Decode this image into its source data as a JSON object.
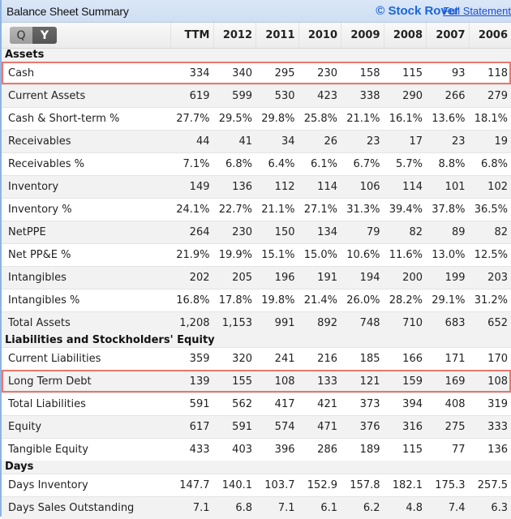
{
  "header": {
    "title": "Balance Sheet Summary",
    "brand": "© Stock Rover",
    "full_statement_link": "Full Statement"
  },
  "period_toggle": {
    "quarterly_label": "Q",
    "yearly_label": "Y",
    "selected": "Y"
  },
  "columns": [
    "TTM",
    "2012",
    "2011",
    "2010",
    "2009",
    "2008",
    "2007",
    "2006"
  ],
  "sections": [
    {
      "title": "Assets",
      "rows": [
        {
          "label": "Cash",
          "values": [
            "334",
            "340",
            "295",
            "230",
            "158",
            "115",
            "93",
            "118"
          ],
          "highlighted": true
        },
        {
          "label": "Current Assets",
          "values": [
            "619",
            "599",
            "530",
            "423",
            "338",
            "290",
            "266",
            "279"
          ]
        },
        {
          "label": "Cash & Short-term %",
          "values": [
            "27.7%",
            "29.5%",
            "29.8%",
            "25.8%",
            "21.1%",
            "16.1%",
            "13.6%",
            "18.1%"
          ]
        },
        {
          "label": "Receivables",
          "values": [
            "44",
            "41",
            "34",
            "26",
            "23",
            "17",
            "23",
            "19"
          ]
        },
        {
          "label": "Receivables %",
          "values": [
            "7.1%",
            "6.8%",
            "6.4%",
            "6.1%",
            "6.7%",
            "5.7%",
            "8.8%",
            "6.8%"
          ]
        },
        {
          "label": "Inventory",
          "values": [
            "149",
            "136",
            "112",
            "114",
            "106",
            "114",
            "101",
            "102"
          ]
        },
        {
          "label": "Inventory %",
          "values": [
            "24.1%",
            "22.7%",
            "21.1%",
            "27.1%",
            "31.3%",
            "39.4%",
            "37.8%",
            "36.5%"
          ]
        },
        {
          "label": "NetPPE",
          "values": [
            "264",
            "230",
            "150",
            "134",
            "79",
            "82",
            "89",
            "82"
          ]
        },
        {
          "label": "Net PP&E %",
          "values": [
            "21.9%",
            "19.9%",
            "15.1%",
            "15.0%",
            "10.6%",
            "11.6%",
            "13.0%",
            "12.5%"
          ]
        },
        {
          "label": "Intangibles",
          "values": [
            "202",
            "205",
            "196",
            "191",
            "194",
            "200",
            "199",
            "203"
          ]
        },
        {
          "label": "Intangibles %",
          "values": [
            "16.8%",
            "17.8%",
            "19.8%",
            "21.4%",
            "26.0%",
            "28.2%",
            "29.1%",
            "31.2%"
          ]
        },
        {
          "label": "Total Assets",
          "values": [
            "1,208",
            "1,153",
            "991",
            "892",
            "748",
            "710",
            "683",
            "652"
          ]
        }
      ]
    },
    {
      "title": "Liabilities and Stockholders' Equity",
      "rows": [
        {
          "label": "Current Liabilities",
          "values": [
            "359",
            "320",
            "241",
            "216",
            "185",
            "166",
            "171",
            "170"
          ]
        },
        {
          "label": "Long Term Debt",
          "values": [
            "139",
            "155",
            "108",
            "133",
            "121",
            "159",
            "169",
            "108"
          ],
          "highlighted": true
        },
        {
          "label": "Total Liabilities",
          "values": [
            "591",
            "562",
            "417",
            "421",
            "373",
            "394",
            "408",
            "319"
          ]
        },
        {
          "label": "Equity",
          "values": [
            "617",
            "591",
            "574",
            "471",
            "376",
            "316",
            "275",
            "333"
          ]
        },
        {
          "label": "Tangible Equity",
          "values": [
            "433",
            "403",
            "396",
            "286",
            "189",
            "115",
            "77",
            "136"
          ]
        }
      ]
    },
    {
      "title": "Days",
      "rows": [
        {
          "label": "Days Inventory",
          "values": [
            "147.7",
            "140.1",
            "103.7",
            "152.9",
            "157.8",
            "182.1",
            "175.3",
            "257.5"
          ]
        },
        {
          "label": "Days Sales Outstanding",
          "values": [
            "7.1",
            "6.8",
            "7.1",
            "6.1",
            "6.2",
            "4.8",
            "7.4",
            "6.3"
          ]
        }
      ]
    }
  ],
  "colors": {
    "highlight_border": "#e8786e",
    "brand": "#1a66d6",
    "link": "#1a4fd6",
    "title_bar": "#d3e2f5"
  }
}
